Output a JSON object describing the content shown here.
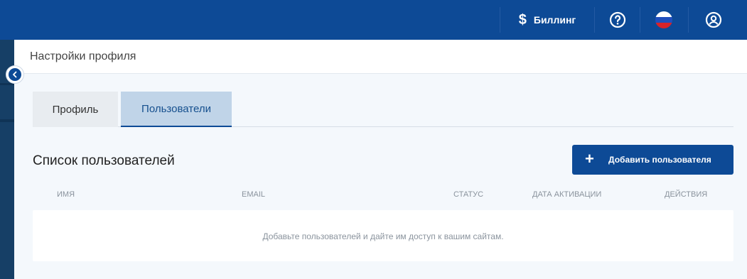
{
  "topbar": {
    "billing_label": "Биллинг",
    "billing_icon": "dollar-icon",
    "help_icon": "help-circle-icon",
    "language_icon": "russian-flag-icon",
    "user_icon": "user-circle-icon",
    "brand_color": "#0d4a96"
  },
  "header": {
    "title": "Настройки профиля"
  },
  "tabs": [
    {
      "label": "Профиль",
      "active": false
    },
    {
      "label": "Пользователи",
      "active": true
    }
  ],
  "users": {
    "section_title": "Список пользователей",
    "add_button_label": "Добавить пользователя",
    "columns": [
      "имя",
      "EMAIL",
      "СТАТУС",
      "ДАТА АКТИВАЦИИ",
      "ДЕЙСТВИЯ"
    ],
    "rows": [],
    "empty_text": "Добавьте пользователей и дайте им доступ к вашим сайтам."
  }
}
